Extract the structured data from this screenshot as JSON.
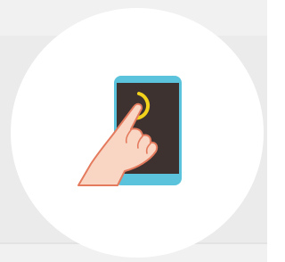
{
  "screen": {
    "background_color": "#ebebeb",
    "badge_color": "#ffffff"
  },
  "illustration": {
    "icon": "hand-tapping-phone-icon",
    "phone_frame_color": "#5bc4dc",
    "phone_screen_color": "#3d3230",
    "tap_ring_color": "#f2d21b",
    "hand_color": "#f9d6c4",
    "hand_outline_color": "#e47b5e"
  }
}
